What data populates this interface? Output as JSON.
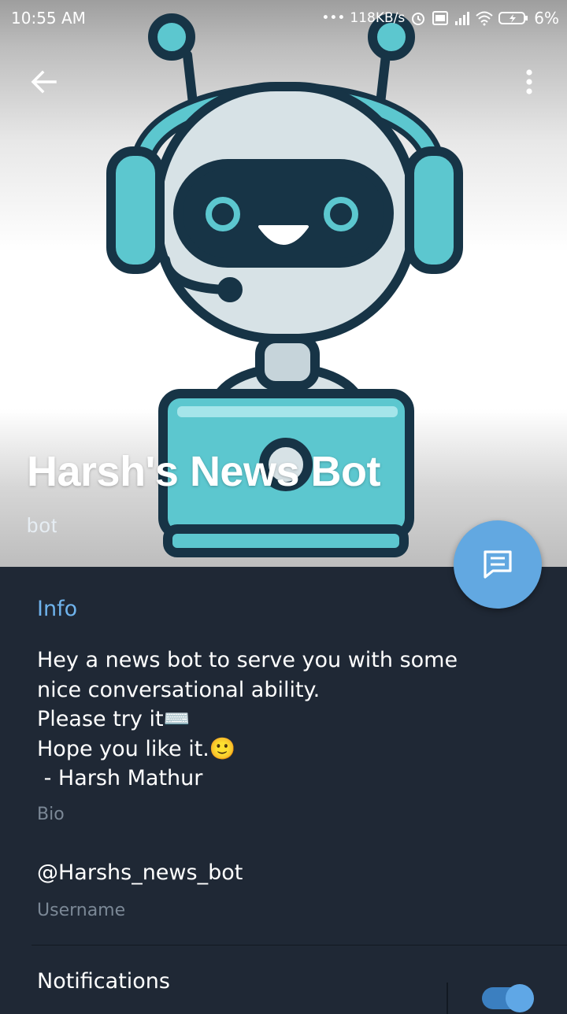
{
  "status_bar": {
    "time": "10:55 AM",
    "network_speed": "118KB/s",
    "battery": "6%",
    "icons": [
      "dots-icon",
      "alarm-icon",
      "volte-icon",
      "signal-icon",
      "wifi-icon",
      "battery-charging-icon"
    ]
  },
  "toolbar": {
    "back_icon": "arrow-left-icon",
    "menu_icon": "more-vertical-icon"
  },
  "profile": {
    "name": "Harsh's News Bot",
    "subtitle": "bot",
    "avatar": "robot-with-headset-illustration"
  },
  "fab": {
    "icon": "message-icon",
    "color": "#62a8e1"
  },
  "info": {
    "section_title": "Info",
    "bio_lines": [
      "Hey a news bot to serve you with some",
      "nice conversational ability.",
      "Please try it⌨️",
      "Hope you like it.🙂",
      " - Harsh Mathur"
    ],
    "bio_label": "Bio",
    "username": "@Harshs_news_bot",
    "username_label": "Username",
    "notifications_label": "Notifications",
    "notifications_enabled": true
  },
  "colors": {
    "background": "#1f2835",
    "accent": "#6fb3ec",
    "muted_text": "#7b8896"
  }
}
